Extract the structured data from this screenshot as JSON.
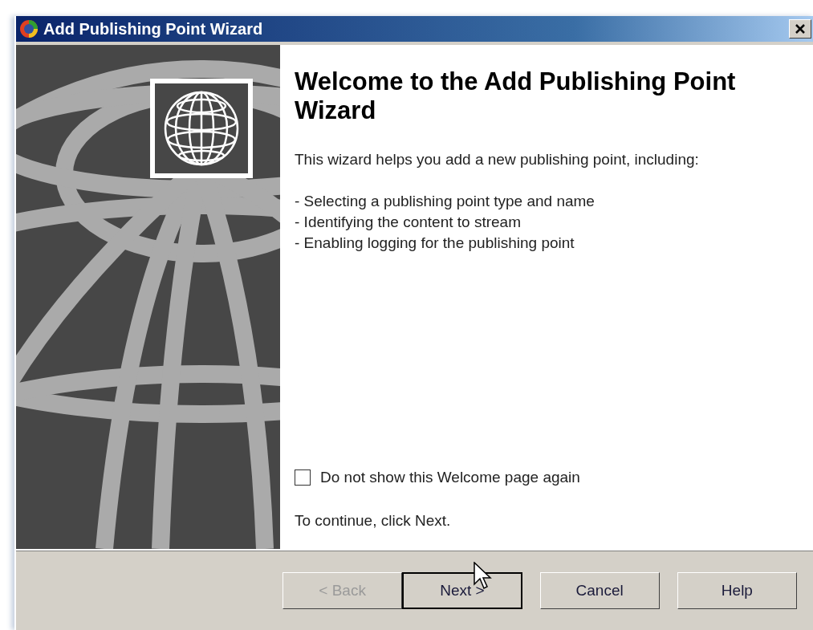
{
  "window": {
    "title": "Add Publishing Point Wizard"
  },
  "heading": "Welcome to the Add Publishing Point Wizard",
  "intro": "This wizard helps you add a new publishing point, including:",
  "bullets": [
    "- Selecting a publishing point type and name",
    "- Identifying the content to stream",
    "- Enabling logging for the publishing point"
  ],
  "checkbox": {
    "label": "Do not show this Welcome page again",
    "checked": false
  },
  "continue_hint": "To continue, click Next.",
  "buttons": [
    {
      "label": "< Back",
      "disabled": true,
      "default": false
    },
    {
      "label": "Next >",
      "disabled": false,
      "default": true
    },
    {
      "label": "Cancel",
      "disabled": false,
      "default": false
    },
    {
      "label": "Help",
      "disabled": false,
      "default": false
    }
  ]
}
